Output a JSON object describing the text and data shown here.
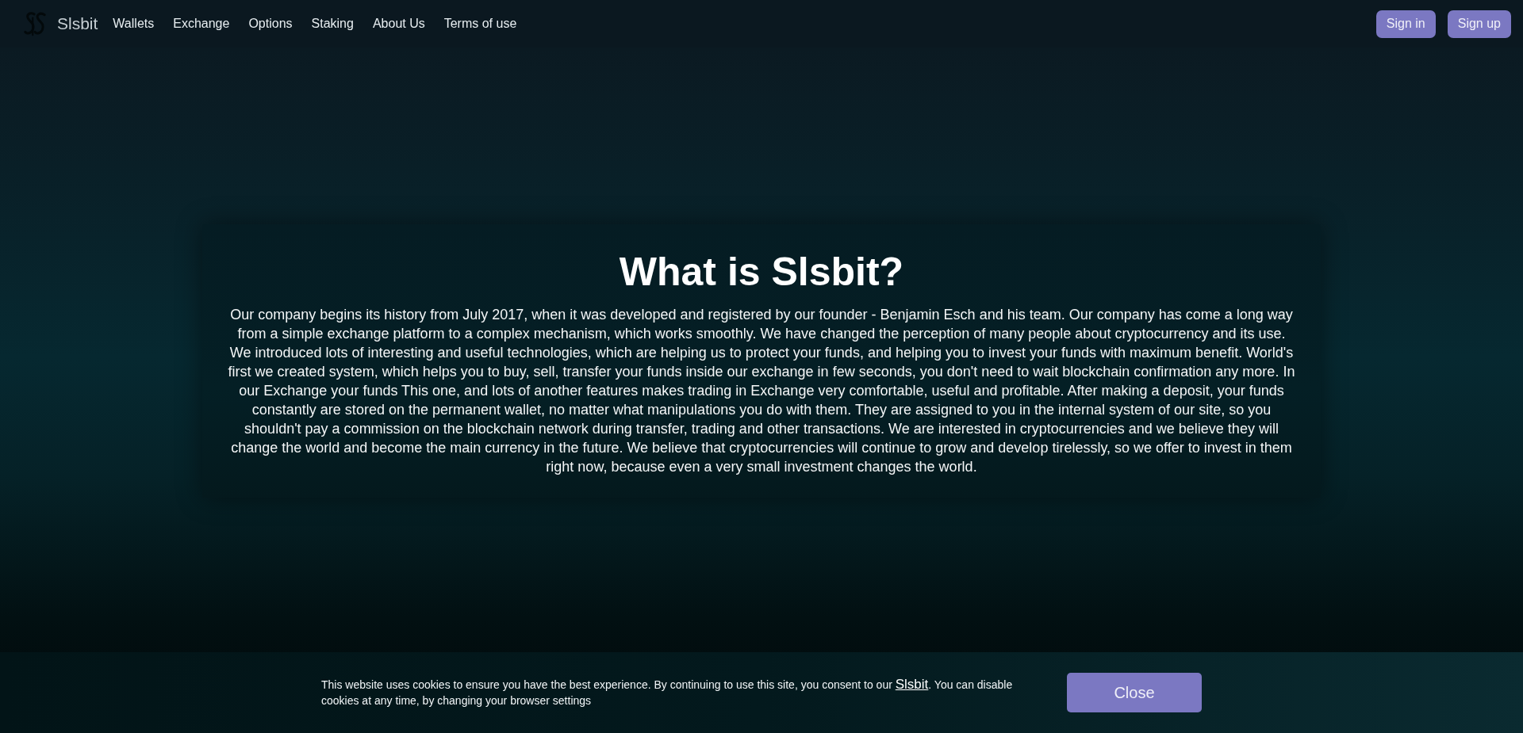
{
  "header": {
    "brand": "Slsbit",
    "nav": [
      "Wallets",
      "Exchange",
      "Options",
      "Staking",
      "About Us",
      "Terms of use"
    ],
    "buttons": [
      "Sign in",
      "Sign up"
    ]
  },
  "about": {
    "title": "What is Slsbit?",
    "body": "Our company begins its history from July 2017, when it was developed and registered by our founder - Benjamin Esch and his team. Our company has come a long way from a simple exchange platform to a complex mechanism, which works smoothly. We have changed the perception of many people about cryptocurrency and its use. We introduced lots of interesting and useful technologies, which are helping us to protect your funds, and helping you to invest your funds with maximum benefit. World's first we created system, which helps you to buy, sell, transfer your funds inside our exchange in few seconds, you don't need to wait blockchain confirmation any more. In our Exchange your funds This one, and lots of another features makes trading in Exchange very comfortable, useful and profitable. After making a deposit, your funds constantly are stored on the permanent wallet, no matter what manipulations you do with them. They are assigned to you in the internal system of our site, so you shouldn't pay a commission on the blockchain network during transfer, trading and other transactions. We are interested in cryptocurrencies and we believe they will change the world and become the main currency in the future. We believe that cryptocurrencies will continue to grow and develop tirelessly, so we offer to invest in them right now, because even a very small investment changes the world."
  },
  "cookie_banner": {
    "text_before": "This website uses cookies to ensure you have the best experience. By continuing to use this site, you consent to our ",
    "link": "Slsbit",
    "text_after": ". You can disable cookies at any time, by changing your browser settings",
    "button": "Close"
  }
}
